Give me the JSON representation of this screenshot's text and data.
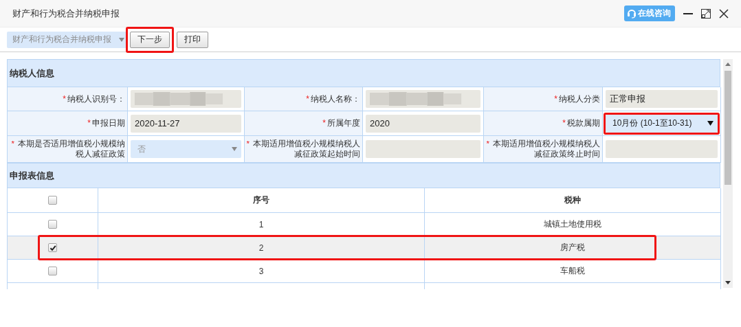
{
  "window": {
    "title": "财产和行为税合并纳税申报",
    "consult_button": "在线咨询"
  },
  "toolbar": {
    "form_select": "财产和行为税合并纳税申报",
    "buttons": [
      {
        "label": "下一步",
        "highlighted": true
      },
      {
        "label": "打印",
        "highlighted": false
      }
    ]
  },
  "taxpayer_section": {
    "title": "纳税人信息",
    "fields": [
      {
        "mark": "*",
        "label": "纳税人识别号：",
        "kind": "redacted",
        "highlighted": false
      },
      {
        "mark": "*",
        "label": "纳税人名称：",
        "kind": "redacted",
        "highlighted": false
      },
      {
        "mark": "*",
        "label": "纳税人分类",
        "kind": "input",
        "value": "正常申报",
        "highlighted": false
      },
      {
        "mark": "*",
        "label": "申报日期",
        "kind": "input",
        "value": "2020-11-27",
        "highlighted": false
      },
      {
        "mark": "*",
        "label": "所属年度",
        "kind": "input",
        "value": "2020",
        "highlighted": false
      },
      {
        "mark": "*",
        "label": "税款属期",
        "kind": "select",
        "value": "10月份 (10-1至10-31)",
        "highlighted": true
      },
      {
        "mark": "*",
        "label": "本期是否适用增值税小规模纳税人减征政策",
        "kind": "select_disabled",
        "value": "否",
        "highlighted": false
      },
      {
        "mark": "*",
        "label": "本期适用增值税小规模纳税人减征政策起始时间",
        "kind": "input",
        "highlighted": false
      },
      {
        "mark": "*",
        "label": "本期适用增值税小规模纳税人减征政策终止时间",
        "kind": "input",
        "highlighted": false
      }
    ]
  },
  "report_section": {
    "title": "申报表信息",
    "table": {
      "header_checked": false,
      "columns": [
        "序号",
        "税种"
      ],
      "rows": [
        {
          "checked": false,
          "selected": false,
          "highlighted": false,
          "cells": [
            "1",
            "城镇土地使用税"
          ]
        },
        {
          "checked": true,
          "selected": true,
          "highlighted": true,
          "cells": [
            "2",
            "房产税"
          ]
        },
        {
          "checked": false,
          "selected": false,
          "highlighted": false,
          "cells": [
            "3",
            "车船税"
          ]
        }
      ]
    }
  }
}
